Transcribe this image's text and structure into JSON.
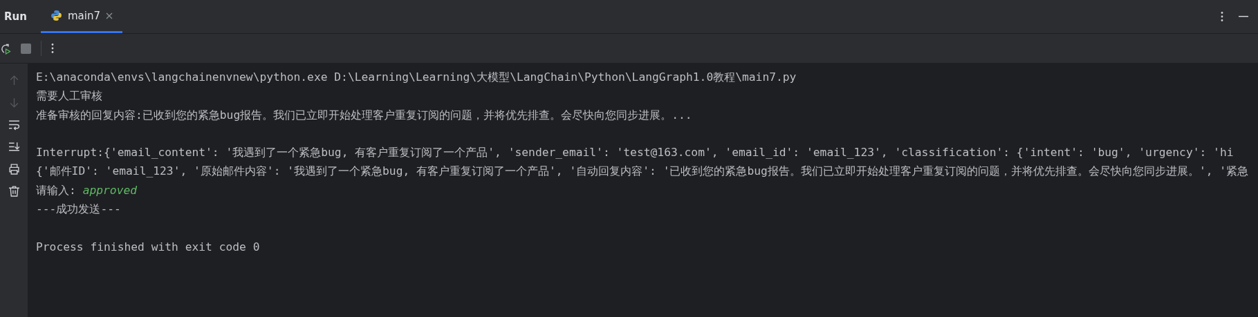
{
  "tool_window": {
    "title": "Run"
  },
  "tabs": [
    {
      "label": "main7",
      "selected": true
    }
  ],
  "gutter_buttons": [
    {
      "disabled": true
    },
    {
      "disabled": true
    },
    {
      "disabled": false
    },
    {
      "disabled": false
    },
    {
      "disabled": false
    },
    {
      "disabled": false
    }
  ],
  "console": [
    {
      "kind": "plain",
      "text": "E:\\anaconda\\envs\\langchainenvnew\\python.exe D:\\Learning\\Learning\\大模型\\LangChain\\Python\\LangGraph1.0教程\\main7.py"
    },
    {
      "kind": "plain",
      "text": "需要人工审核"
    },
    {
      "kind": "plain",
      "text": "准备审核的回复内容:已收到您的紧急bug报告。我们已立即开始处理客户重复订阅的问题，并将优先排查。会尽快向您同步进展。..."
    },
    {
      "kind": "blank"
    },
    {
      "kind": "plain",
      "text": "Interrupt:{'email_content': '我遇到了一个紧急bug, 有客户重复订阅了一个产品', 'sender_email': 'test@163.com', 'email_id': 'email_123', 'classification': {'intent': 'bug', 'urgency': 'hi"
    },
    {
      "kind": "plain",
      "text": "{'邮件ID': 'email_123', '原始邮件内容': '我遇到了一个紧急bug, 有客户重复订阅了一个产品', '自动回复内容': '已收到您的紧急bug报告。我们已立即开始处理客户重复订阅的问题，并将优先排查。会尽快向您同步进展。', '紧急"
    },
    {
      "kind": "input",
      "prompt": "请输入:",
      "value": "approved"
    },
    {
      "kind": "plain",
      "text": "---成功发送---"
    },
    {
      "kind": "blank"
    },
    {
      "kind": "plain",
      "text": "Process finished with exit code 0"
    }
  ]
}
